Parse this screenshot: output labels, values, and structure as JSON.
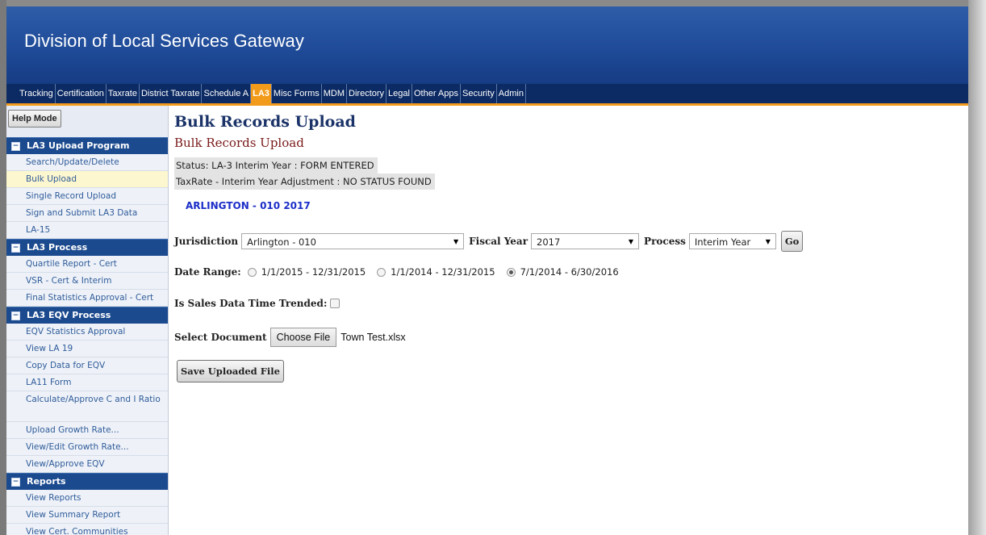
{
  "header": {
    "title": "Division of Local Services Gateway"
  },
  "nav": {
    "items": [
      "Tracking",
      "Certification",
      "Taxrate",
      "District Taxrate",
      "Schedule A",
      "LA3",
      "Misc Forms",
      "MDM",
      "Directory",
      "Legal",
      "Other Apps",
      "Security",
      "Admin"
    ],
    "active": "LA3"
  },
  "sidebar": {
    "help_label": "Help Mode",
    "groups": [
      {
        "title": "LA3 Upload Program",
        "items": [
          "Search/Update/Delete",
          "Bulk Upload",
          "Single Record Upload",
          "Sign and Submit LA3 Data",
          "LA-15"
        ]
      },
      {
        "title": "LA3 Process",
        "items": [
          "Quartile Report - Cert",
          "VSR - Cert & Interim",
          "Final Statistics Approval - Cert"
        ]
      },
      {
        "title": "LA3 EQV Process",
        "items": [
          "EQV Statistics Approval",
          "View LA 19",
          "Copy Data for EQV",
          "LA11 Form",
          "Calculate/Approve C and I Ratio",
          "Upload Growth Rate...",
          "View/Edit Growth Rate...",
          "View/Approve EQV"
        ]
      },
      {
        "title": "Reports",
        "items": [
          "View Reports",
          "View Summary Report",
          "View Cert. Communities"
        ]
      }
    ],
    "toggle_symbol": "−"
  },
  "main": {
    "title": "Bulk Records Upload",
    "subtitle": "Bulk Records Upload",
    "status_line1": "Status: LA-3 Interim Year : FORM ENTERED",
    "status_line2": "TaxRate - Interim Year Adjustment : NO STATUS FOUND",
    "entity": "ARLINGTON - 010 2017",
    "jurisdiction_label": "Jurisdiction",
    "jurisdiction_value": "Arlington - 010",
    "fiscal_year_label": "Fiscal Year",
    "fiscal_year_value": "2017",
    "process_label": "Process",
    "process_value": "Interim Year",
    "go_label": "Go",
    "date_range_label": "Date Range:",
    "date_ranges": [
      "1/1/2015 - 12/31/2015",
      "1/1/2014 - 12/31/2015",
      "7/1/2014 - 6/30/2016"
    ],
    "date_range_selected": "7/1/2014 - 6/30/2016",
    "time_trended_label": "Is Sales Data Time Trended:",
    "time_trended_checked": false,
    "select_document_label": "Select Document",
    "choose_file_label": "Choose File",
    "file_name": "Town Test.xlsx",
    "save_label": "Save Uploaded File"
  }
}
